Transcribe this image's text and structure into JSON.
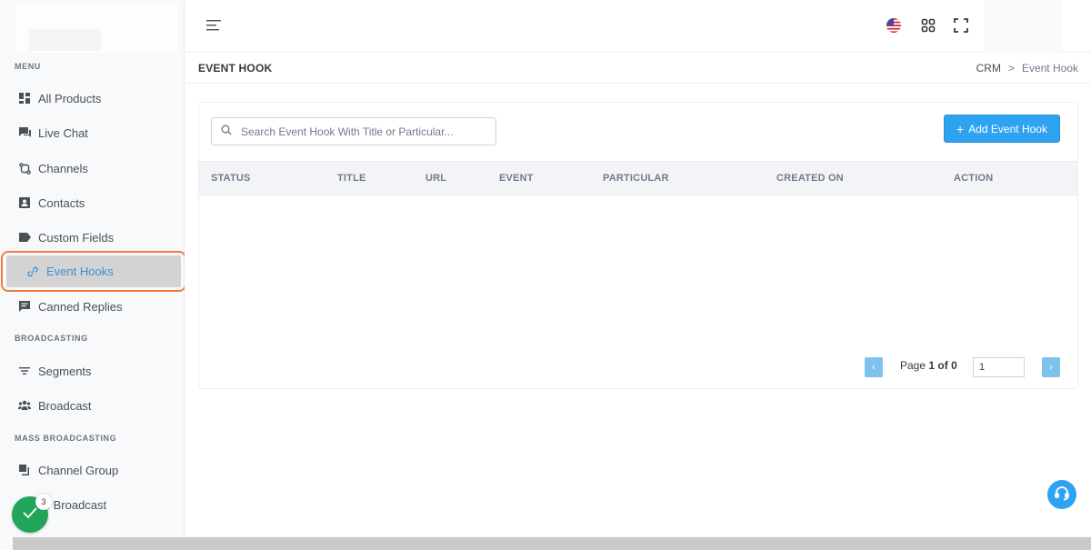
{
  "sidebar": {
    "sections": {
      "menu": "MENU",
      "broadcasting": "BROADCASTING",
      "mass_broadcasting": "MASS BROADCASTING"
    },
    "items": [
      {
        "label": "All Products",
        "icon": "grid-icon"
      },
      {
        "label": "Live Chat",
        "icon": "chat-icon"
      },
      {
        "label": "Channels",
        "icon": "channels-icon"
      },
      {
        "label": "Contacts",
        "icon": "contact-card-icon"
      },
      {
        "label": "Custom Fields",
        "icon": "tag-icon"
      },
      {
        "label": "Event Hooks",
        "icon": "link-icon"
      },
      {
        "label": "Canned Replies",
        "icon": "message-square-icon"
      },
      {
        "label": "Segments",
        "icon": "filter-icon"
      },
      {
        "label": "Broadcast",
        "icon": "users-icon"
      },
      {
        "label": "Channel Group",
        "icon": "copy-icon"
      },
      {
        "label": "Mass Broadcast",
        "icon": "megaphone-icon"
      }
    ],
    "mass_broadcast_visible": "ss Broadcast"
  },
  "header": {
    "page_title": "EVENT HOOK",
    "breadcrumb": {
      "root": "CRM",
      "separator": ">",
      "current": "Event Hook"
    }
  },
  "toolbar": {
    "search_placeholder": "Search Event Hook With Title or Particular...",
    "add_button_label": "Add Event Hook",
    "add_button_plus": "+"
  },
  "table": {
    "columns": [
      "STATUS",
      "TITLE",
      "URL",
      "EVENT",
      "PARTICULAR",
      "CREATED ON",
      "ACTION"
    ],
    "rows": []
  },
  "pagination": {
    "prefix": "Page",
    "current": "1",
    "of_label": "of",
    "total": "0",
    "input_value": "1",
    "prev": "‹",
    "next": "›"
  },
  "notification": {
    "count": "3"
  },
  "colors": {
    "accent": "#2ea3f2",
    "active_outline": "#f07b3f",
    "active_text": "#3a8fd6",
    "success": "#22a55a"
  }
}
